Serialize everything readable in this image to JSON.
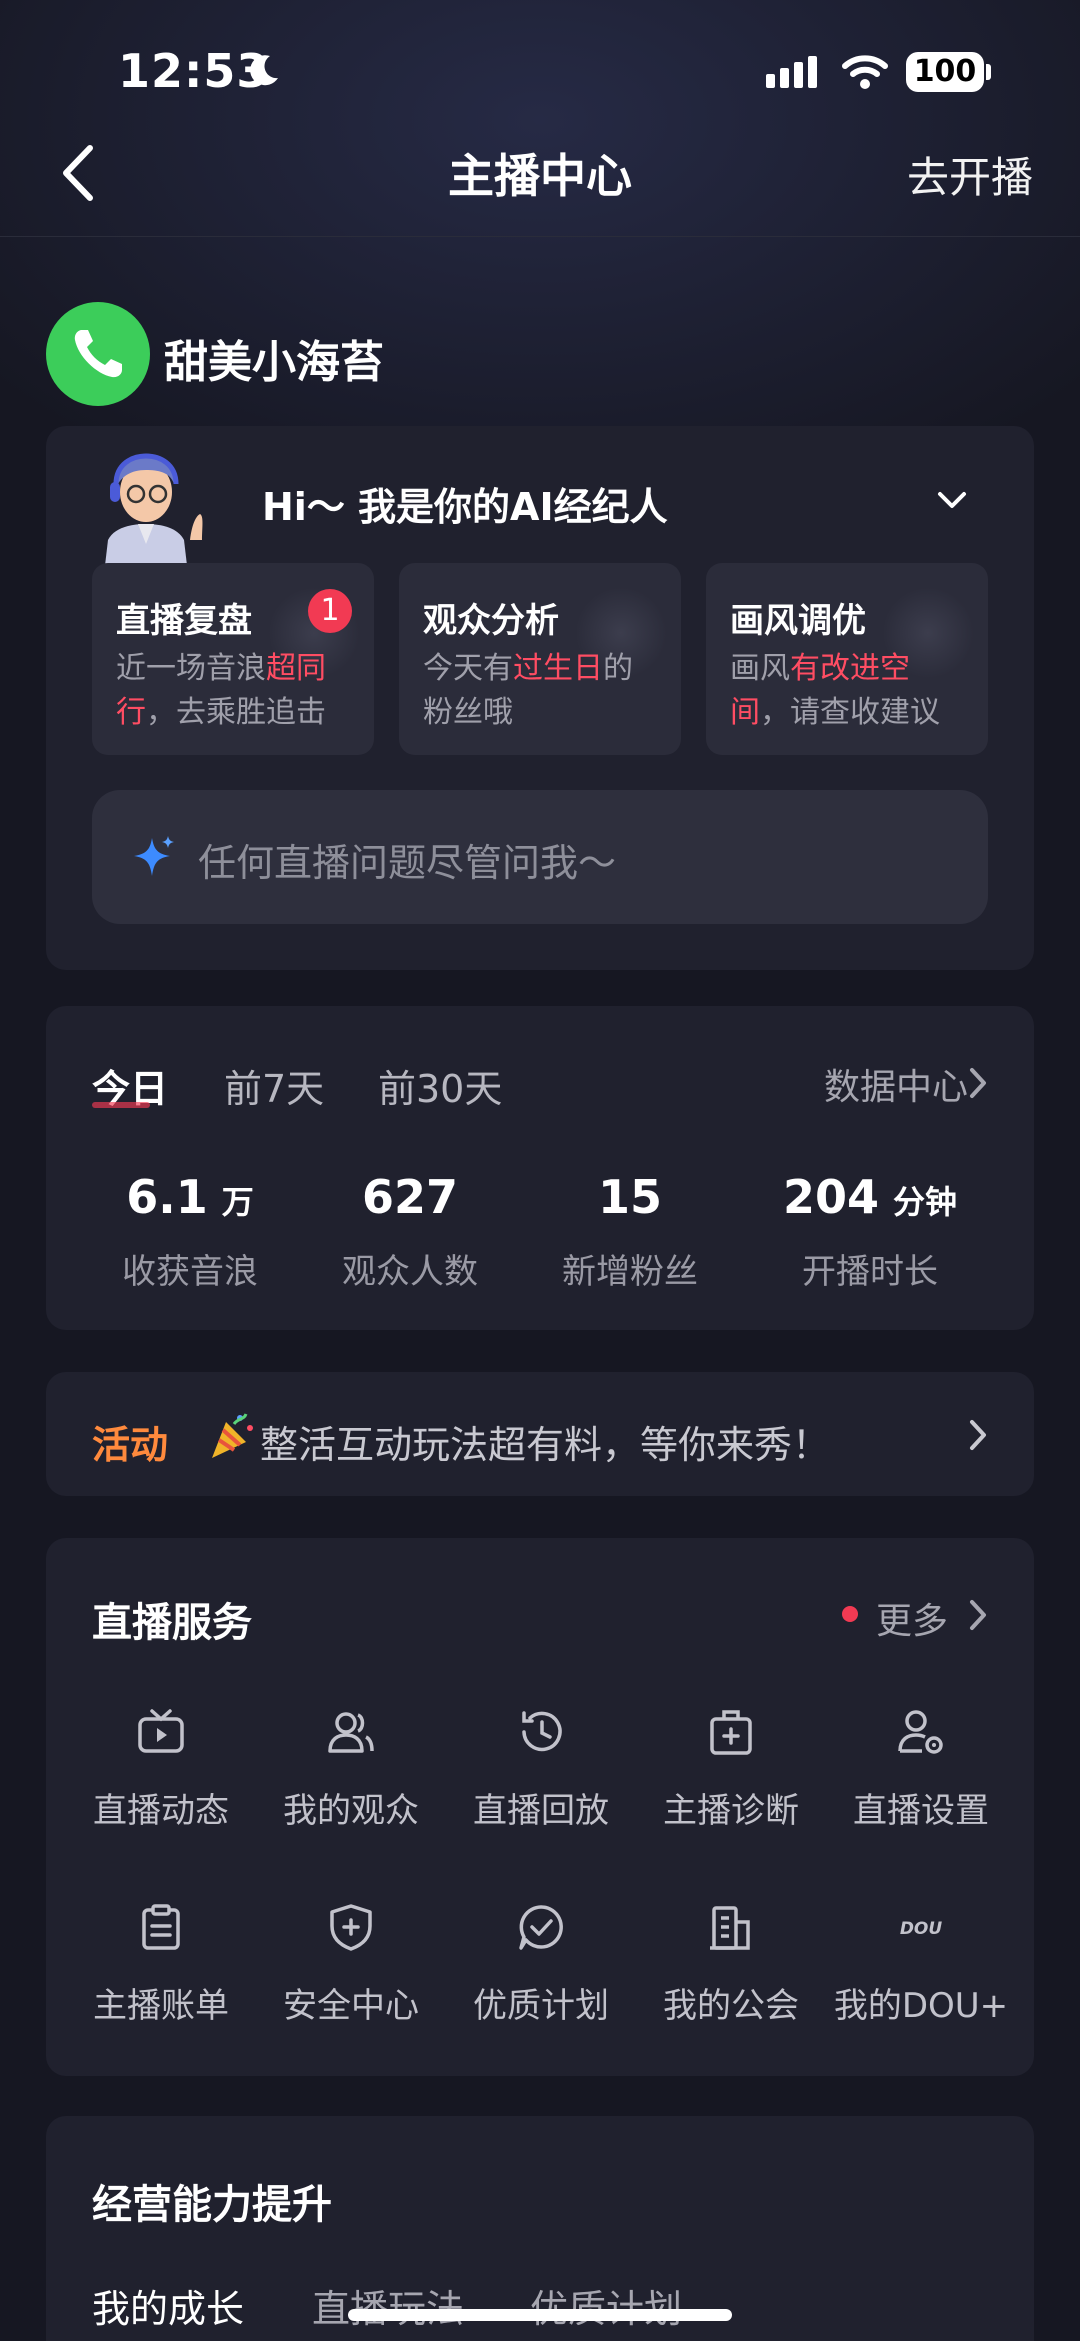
{
  "status_bar": {
    "time": "12:53",
    "battery": "100"
  },
  "nav": {
    "title": "主播中心",
    "right_action": "去开播"
  },
  "user": {
    "name": "甜美小海苔"
  },
  "ai_agent": {
    "greeting": "Hi～ 我是你的AI经纪人",
    "cards": [
      {
        "title": "直播复盘",
        "badge": "1",
        "desc_before": "近一场音浪",
        "desc_highlight": "超同行",
        "desc_after": "，去乘胜追击"
      },
      {
        "title": "观众分析",
        "desc_before": "今天有",
        "desc_highlight": "过生日",
        "desc_after": "的粉丝哦"
      },
      {
        "title": "画风调优",
        "desc_before": "画风",
        "desc_highlight": "有改进空间",
        "desc_after": "，请查收建议"
      }
    ],
    "ask_placeholder": "任何直播问题尽管问我～"
  },
  "stats": {
    "tabs": [
      "今日",
      "前7天",
      "前30天"
    ],
    "active_tab": "今日",
    "data_center": "数据中心",
    "items": [
      {
        "value": "6.1",
        "unit": "万",
        "label": "收获音浪"
      },
      {
        "value": "627",
        "unit": "",
        "label": "观众人数"
      },
      {
        "value": "15",
        "unit": "",
        "label": "新增粉丝"
      },
      {
        "value": "204",
        "unit": "分钟",
        "label": "开播时长"
      }
    ]
  },
  "activity": {
    "label": "活动",
    "text": "整活互动玩法超有料，等你来秀！"
  },
  "services": {
    "title": "直播服务",
    "more": "更多",
    "items": [
      {
        "label": "直播动态",
        "icon": "tv-play-icon"
      },
      {
        "label": "我的观众",
        "icon": "audience-icon"
      },
      {
        "label": "直播回放",
        "icon": "replay-clock-icon"
      },
      {
        "label": "主播诊断",
        "icon": "medical-kit-icon"
      },
      {
        "label": "直播设置",
        "icon": "user-settings-icon"
      },
      {
        "label": "主播账单",
        "icon": "clipboard-icon"
      },
      {
        "label": "安全中心",
        "icon": "shield-plus-icon"
      },
      {
        "label": "优质计划",
        "icon": "check-bubble-icon"
      },
      {
        "label": "我的公会",
        "icon": "building-icon"
      },
      {
        "label": "我的DOU+",
        "icon": "dou-logo-icon",
        "logo_text": "DOU"
      }
    ]
  },
  "growth": {
    "title": "经营能力提升",
    "tabs": [
      "我的成长",
      "直播玩法",
      "优质计划"
    ]
  },
  "colors": {
    "accent": "#f23a53",
    "activity": "#ff8a3d",
    "background": "#161722",
    "card": "#20212e"
  }
}
